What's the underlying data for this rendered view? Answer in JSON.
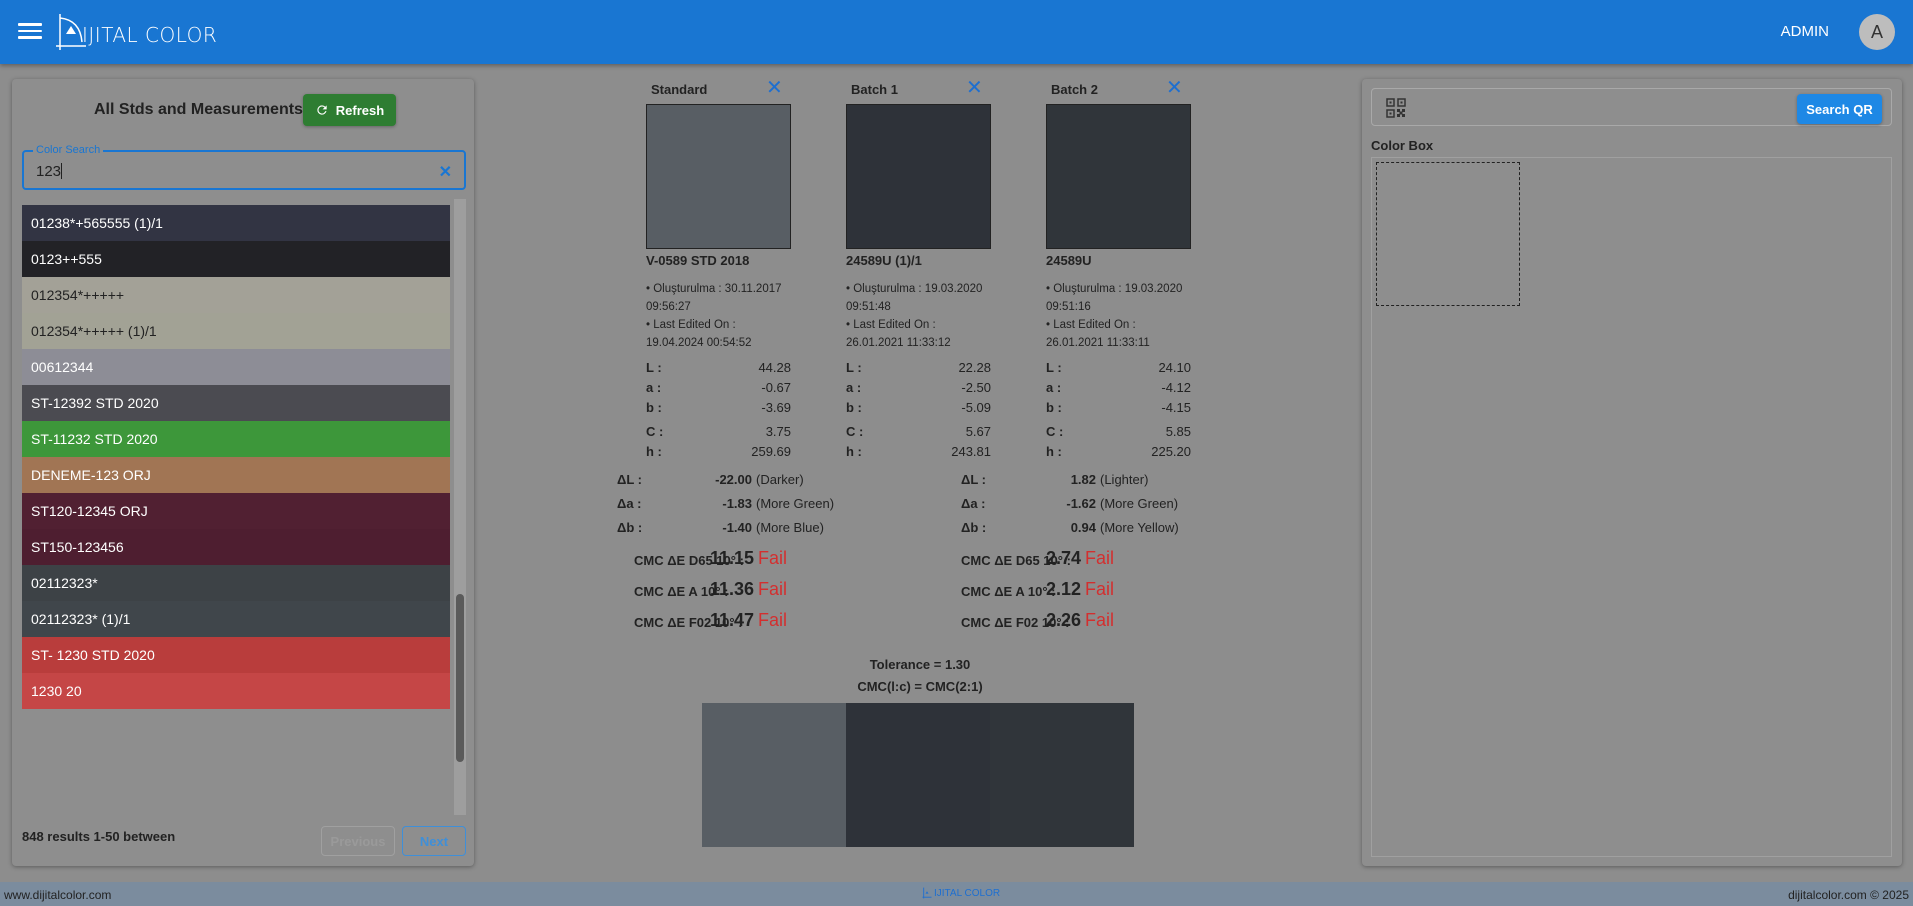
{
  "app": {
    "logo_text": "IJITAL COLOR",
    "user_name": "ADMIN",
    "avatar_initial": "A"
  },
  "left_panel": {
    "title": "All Stds and Measurements",
    "refresh_label": "Refresh",
    "search": {
      "legend": "Color Search",
      "value": "123"
    },
    "items": [
      {
        "label": "01238*+565555 (1)/1",
        "bg": "#323443",
        "fg": "#ffffff"
      },
      {
        "label": "0123++555",
        "bg": "#222226",
        "fg": "#ffffff"
      },
      {
        "label": "012354*+++++",
        "bg": "#a3a197",
        "fg": "#222222"
      },
      {
        "label": "012354*+++++ (1)/1",
        "bg": "#a2a295",
        "fg": "#222222"
      },
      {
        "label": "00612344",
        "bg": "#8d8d96",
        "fg": "#ffffff"
      },
      {
        "label": "ST-12392 STD 2020",
        "bg": "#4b4b51",
        "fg": "#ffffff"
      },
      {
        "label": "ST-11232 STD 2020",
        "bg": "#3d973a",
        "fg": "#ffffff"
      },
      {
        "label": "DENEME-123 ORJ",
        "bg": "#a17554",
        "fg": "#ffffff"
      },
      {
        "label": "ST120-12345 ORJ",
        "bg": "#512032",
        "fg": "#ffffff"
      },
      {
        "label": "ST150-123456",
        "bg": "#4e1e30",
        "fg": "#ffffff"
      },
      {
        "label": "02112323*",
        "bg": "#3d4246",
        "fg": "#ffffff"
      },
      {
        "label": "02112323* (1)/1",
        "bg": "#40464b",
        "fg": "#ffffff"
      },
      {
        "label": "ST- 1230 STD 2020",
        "bg": "#b93d3c",
        "fg": "#ffffff"
      },
      {
        "label": "1230 20",
        "bg": "#c54646",
        "fg": "#ffffff"
      }
    ],
    "results_text": "848 results 1-50 between",
    "prev_label": "Previous",
    "next_label": "Next"
  },
  "samples": [
    {
      "header": "Standard",
      "id": "V-0589 STD 2018",
      "color": "#585e64",
      "created_label": "• Oluşturulma : 30.11.2017",
      "created_time": "09:56:27",
      "edited_label": "• Last Edited On :",
      "edited_time": "19.04.2024 00:54:52",
      "L": "44.28",
      "a": "-0.67",
      "b": "-3.69",
      "C": "3.75",
      "h": "259.69"
    },
    {
      "header": "Batch 1",
      "id": "24589U (1)/1",
      "color": "#2e3239",
      "created_label": "• Oluşturulma : 19.03.2020",
      "created_time": "09:51:48",
      "edited_label": "• Last Edited On :",
      "edited_time": "26.01.2021 11:33:12",
      "L": "22.28",
      "a": "-2.50",
      "b": "-5.09",
      "C": "5.67",
      "h": "243.81"
    },
    {
      "header": "Batch 2",
      "id": "24589U",
      "color": "#30353a",
      "created_label": "• Oluşturulma : 19.03.2020",
      "created_time": "09:51:16",
      "edited_label": "• Last Edited On :",
      "edited_time": "26.01.2021 11:33:11",
      "L": "24.10",
      "a": "-4.12",
      "b": "-4.15",
      "C": "5.85",
      "h": "225.20"
    }
  ],
  "lab_keys": {
    "L": "L :",
    "a": "a :",
    "b": "b :",
    "C": "C :",
    "h": "h :"
  },
  "comparisons": [
    {
      "dL": "-22.00",
      "dL_desc": "(Darker)",
      "da": "-1.83",
      "da_desc": "(More Green)",
      "db": "-1.40",
      "db_desc": "(More Blue)",
      "d65": "11.15",
      "a10": "11.36",
      "f02": "11.47",
      "result": "Fail"
    },
    {
      "dL": "1.82",
      "dL_desc": "(Lighter)",
      "da": "-1.62",
      "da_desc": "(More Green)",
      "db": "0.94",
      "db_desc": "(More Yellow)",
      "d65": "2.74",
      "a10": "2.12",
      "f02": "2.26",
      "result": "Fail"
    }
  ],
  "delta_keys": {
    "dL": "ΔL :",
    "da": "Δa :",
    "db": "Δb :"
  },
  "cmc_keys": {
    "d65": "CMC ΔE D65 10° :",
    "a10": "CMC ΔE A 10° :",
    "f02": "CMC ΔE F02 10° :"
  },
  "tolerance": {
    "line1": "Tolerance = 1.30",
    "line2": "CMC(l:c) = CMC(2:1)"
  },
  "right_panel": {
    "search_qr_label": "Search QR",
    "color_box_label": "Color Box"
  },
  "footer": {
    "left": "www.dijitalcolor.com",
    "right": "dijitalcolor.com © 2025",
    "logo_text": "IJITAL COLOR"
  },
  "colors": {
    "primary": "#1976d2",
    "refresh": "#2e7d32",
    "fail": "#d32f2f"
  }
}
